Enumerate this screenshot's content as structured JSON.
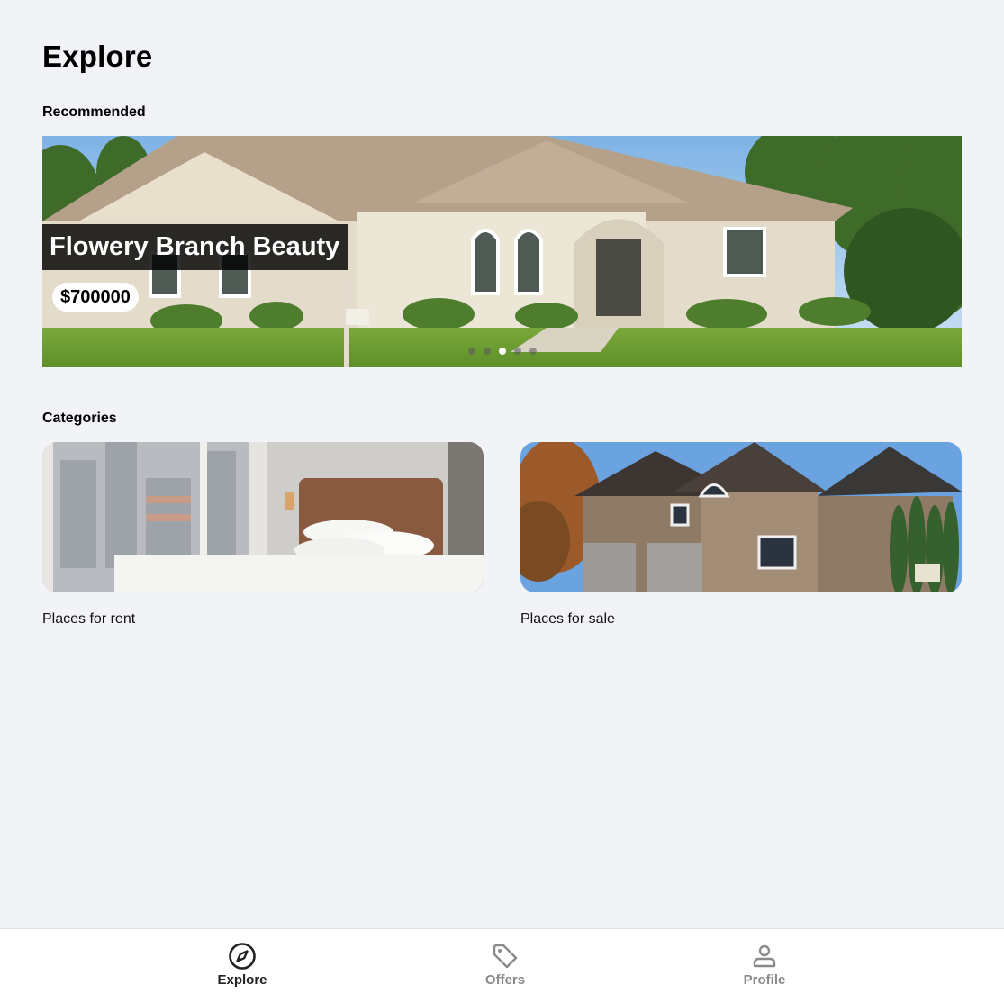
{
  "header": {
    "title": "Explore"
  },
  "recommended": {
    "section_title": "Recommended",
    "featured": {
      "title": "Flowery Branch Beauty",
      "price": "$700000"
    },
    "slide_count": 5,
    "active_slide": 3
  },
  "categories": {
    "section_title": "Categories",
    "items": [
      {
        "label": "Places for rent"
      },
      {
        "label": "Places for sale"
      }
    ]
  },
  "bottom_nav": {
    "items": [
      {
        "label": "Explore",
        "icon": "compass-icon",
        "active": true
      },
      {
        "label": "Offers",
        "icon": "tag-icon",
        "active": false
      },
      {
        "label": "Profile",
        "icon": "person-icon",
        "active": false
      }
    ]
  },
  "colors": {
    "background": "#f2f3f7",
    "nav_active": "#222222",
    "nav_inactive": "#8a8a8a",
    "title_overlay": "#000000"
  }
}
